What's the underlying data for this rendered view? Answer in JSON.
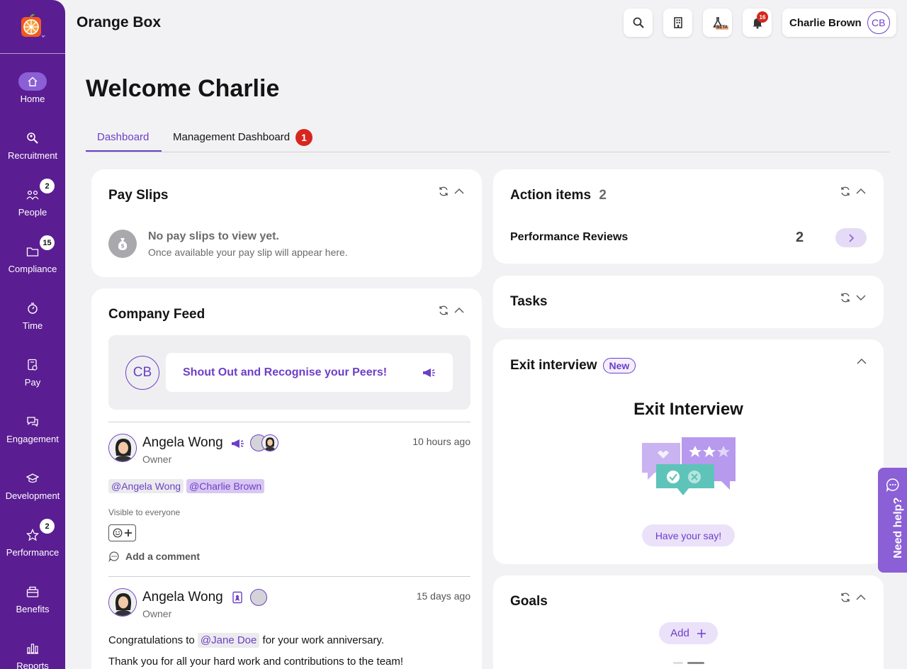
{
  "app": {
    "title": "Orange Box"
  },
  "sidebar": {
    "items": [
      {
        "label": "Home",
        "badge": ""
      },
      {
        "label": "Recruitment",
        "badge": ""
      },
      {
        "label": "People",
        "badge": "2"
      },
      {
        "label": "Compliance",
        "badge": "15"
      },
      {
        "label": "Time",
        "badge": ""
      },
      {
        "label": "Pay",
        "badge": ""
      },
      {
        "label": "Engagement",
        "badge": ""
      },
      {
        "label": "Development",
        "badge": ""
      },
      {
        "label": "Performance",
        "badge": "2"
      },
      {
        "label": "Benefits",
        "badge": ""
      },
      {
        "label": "Reports",
        "badge": ""
      }
    ]
  },
  "header": {
    "beta_label": "BETA",
    "notifications_count": "16",
    "user_name": "Charlie Brown",
    "user_initials": "CB"
  },
  "welcome": {
    "title": "Welcome Charlie"
  },
  "tabs": [
    {
      "label": "Dashboard"
    },
    {
      "label": "Management Dashboard",
      "badge": "1"
    }
  ],
  "payslips": {
    "title": "Pay Slips",
    "empty_title": "No pay slips to view yet.",
    "empty_text": "Once available your pay slip will appear here."
  },
  "feed": {
    "title": "Company Feed",
    "composer_initials": "CB",
    "composer_prompt": "Shout Out and Recognise your Peers!",
    "posts": [
      {
        "author": "Angela Wong",
        "role": "Owner",
        "time": "10 hours ago",
        "mentions": [
          "@Angela Wong",
          "@Charlie Brown"
        ],
        "visibility": "Visible to everyone",
        "comment_label": "Add a comment"
      },
      {
        "author": "Angela Wong",
        "role": "Owner",
        "time": "15 days ago",
        "text_before": "Congratulations to",
        "mention": "@Jane Doe",
        "text_after": "for your work anniversary.",
        "line2": "Thank you for all your hard work and contributions to the team!"
      }
    ]
  },
  "action_items": {
    "title": "Action items",
    "count": "2",
    "rows": [
      {
        "label": "Performance Reviews",
        "count": "2"
      }
    ]
  },
  "tasks": {
    "title": "Tasks"
  },
  "exit_interview": {
    "title": "Exit interview",
    "badge": "New",
    "heading": "Exit Interview",
    "cta": "Have your say!"
  },
  "goals": {
    "title": "Goals",
    "add_label": "Add"
  },
  "help": {
    "label": "Need help?"
  },
  "colors": {
    "sidebar": "#5b1d92",
    "accent": "#6d3fc7",
    "badge_red": "#d7261e",
    "help": "#8b5fd6"
  }
}
